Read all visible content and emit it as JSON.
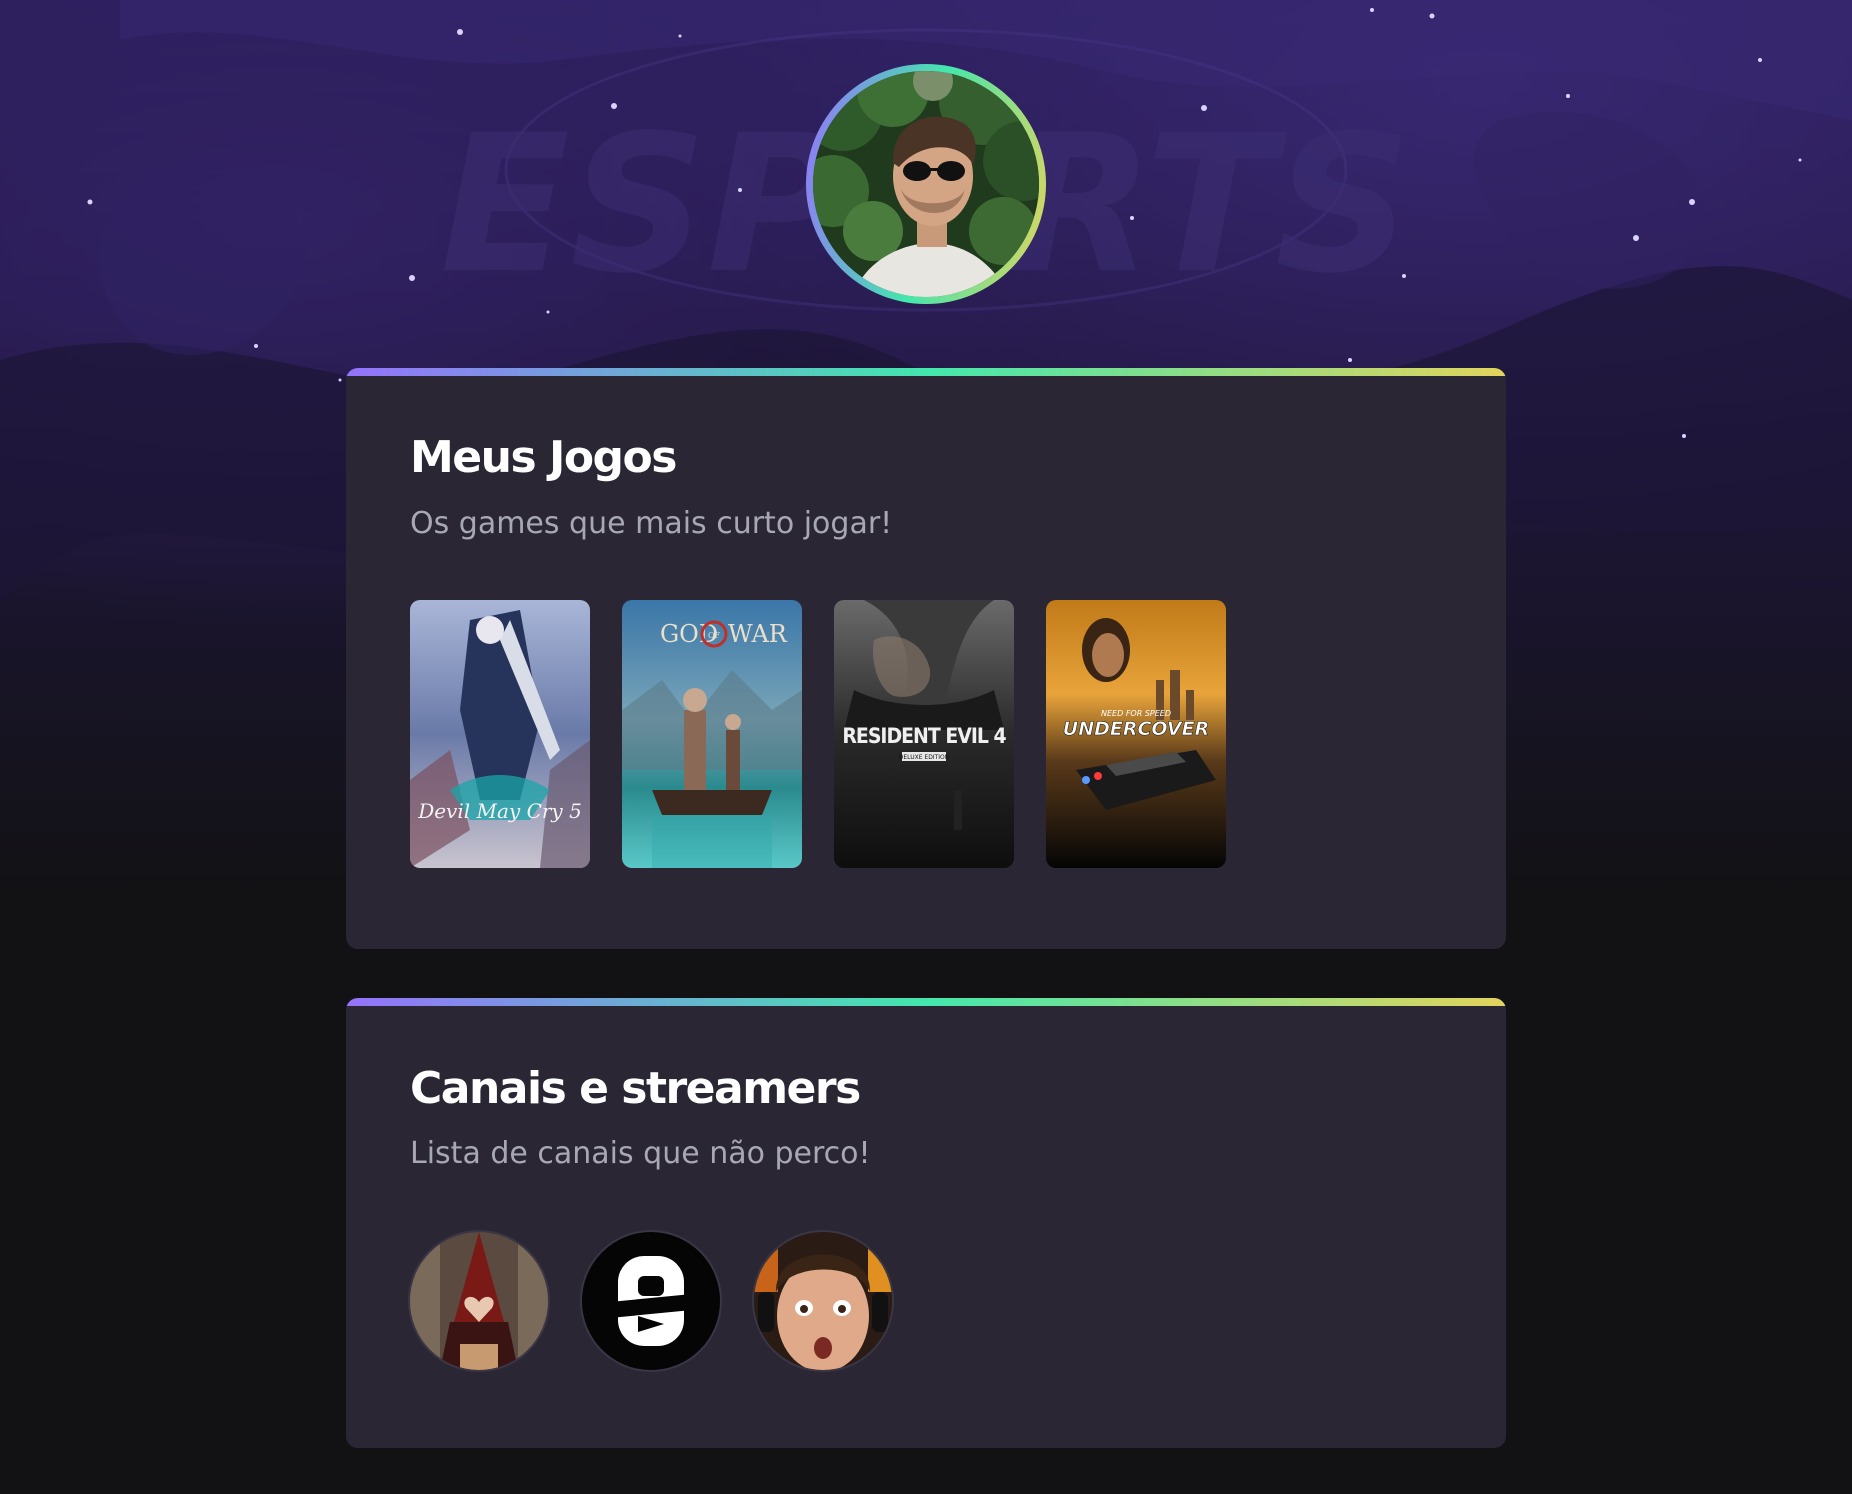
{
  "profile": {
    "avatar_alt": "profile-photo"
  },
  "background": {
    "watermark_text": "ESPORTS"
  },
  "games_section": {
    "title": "Meus Jogos",
    "subtitle": "Os games que mais curto jogar!",
    "games": [
      {
        "logo_line1": "Devil May Cry 5",
        "logo_line2": ""
      },
      {
        "logo_line1": "GOD",
        "logo_of": "OF",
        "logo_line2": "WAR"
      },
      {
        "logo_line1": "RESIDENT EVIL 4",
        "logo_line2": "DELUXE EDITION"
      },
      {
        "logo_line1": "NEED FOR SPEED",
        "logo_line2": "UNDERCOVER"
      }
    ]
  },
  "streamers_section": {
    "title": "Canais e streamers",
    "subtitle": "Lista de canais que não perco!",
    "streamers": [
      {
        "name": "streamer-1"
      },
      {
        "name": "streamer-2"
      },
      {
        "name": "streamer-3"
      }
    ]
  },
  "colors": {
    "gradient_start": "#9572fc",
    "gradient_mid": "#43e7ad",
    "gradient_end": "#e2d45c",
    "card_bg": "#2a2634",
    "page_bg": "#121214"
  }
}
